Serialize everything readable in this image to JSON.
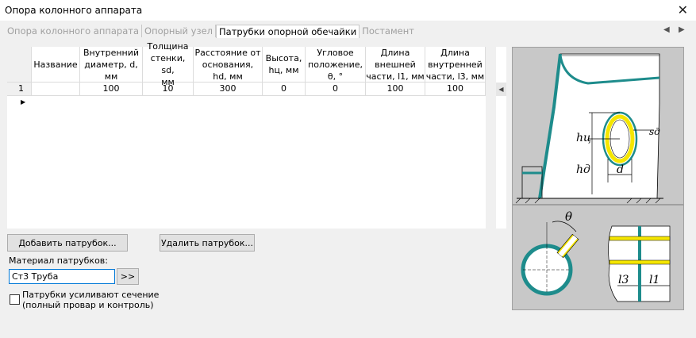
{
  "window": {
    "title": "Опора колонного аппарата",
    "close_symbol": "✕"
  },
  "tabs": [
    {
      "label": "Опора колонного аппарата",
      "active": false
    },
    {
      "label": "Опорный узел",
      "active": false
    },
    {
      "label": "Патрубки опорной обечайки",
      "active": true
    },
    {
      "label": "Постамент",
      "active": false
    }
  ],
  "tab_nav": {
    "prev": "◀",
    "next": "▶"
  },
  "table": {
    "headers": [
      "Название",
      "Внутренний\nдиаметр, d,\nмм",
      "Толщина\nстенки, sd,\nмм",
      "Расстояние от\nоснования,\nhd, мм",
      "Высота,\nhц, мм",
      "Угловое\nположение,\nθ, °",
      "Длина\nвнешней\nчасти, l1, мм",
      "Длина\nвнутренней\nчасти, l3, мм"
    ],
    "rows": [
      {
        "num": "1",
        "marker": "▶",
        "cells": [
          "",
          "100",
          "10",
          "300",
          "0",
          "0",
          "100",
          "100"
        ]
      }
    ],
    "scroll_marker": "◀"
  },
  "buttons": {
    "add": "Добавить патрубок...",
    "delete": "Удалить патрубок...",
    "browse": ">>"
  },
  "material": {
    "label": "Материал патрубков:",
    "value": "Ст3 Труба"
  },
  "checkbox": {
    "line1": "Патрубки усиливают сечение",
    "line2": "(полный провар и контроль)",
    "checked": false
  },
  "drawing": {
    "labels": {
      "h_c": "hц",
      "h_d": "hд",
      "d": "d",
      "s_d": "sд",
      "theta": "θ",
      "l3": "l3",
      "l1": "l1"
    }
  }
}
